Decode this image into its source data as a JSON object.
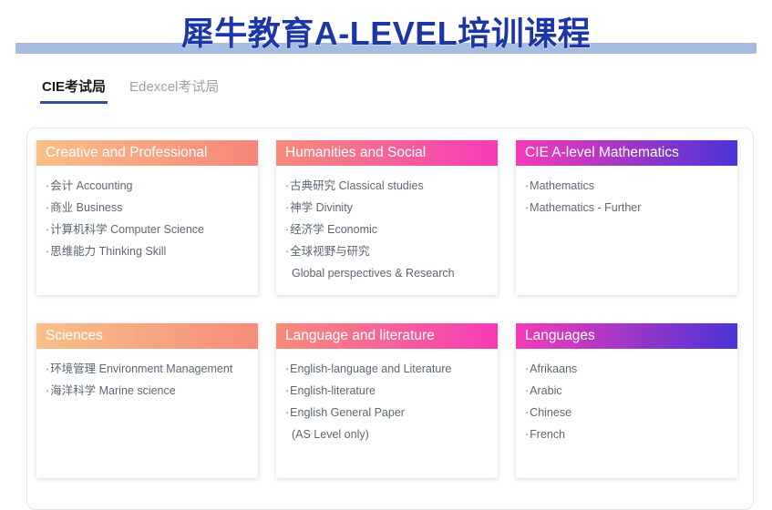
{
  "page": {
    "title": "犀牛教育A-LEVEL培训课程",
    "accent_bar_color": "#a8bce0",
    "title_color": "#1b36a6"
  },
  "tabs": [
    {
      "label": "CIE考试局",
      "active": true
    },
    {
      "label": "Edexcel考试局",
      "active": false
    }
  ],
  "cards": [
    {
      "title": "Creative and Professional",
      "gradient_from": "#f9c088",
      "gradient_to": "#f58679",
      "items": [
        {
          "text": "会计 Accounting",
          "bullet": true
        },
        {
          "text": "商业 Business",
          "bullet": true
        },
        {
          "text": "计算机科学 Computer Science",
          "bullet": true
        },
        {
          "text": "思维能力 Thinking Skill",
          "bullet": true
        }
      ]
    },
    {
      "title": "Humanities and Social",
      "gradient_from": "#f68c7a",
      "gradient_to": "#f53bb6",
      "items": [
        {
          "text": "古典研究 Classical studies",
          "bullet": true
        },
        {
          "text": "神学 Divinity",
          "bullet": true
        },
        {
          "text": "经济学 Economic",
          "bullet": true
        },
        {
          "text": "全球视野与研究",
          "bullet": true
        },
        {
          "text": "Global perspectives & Research",
          "bullet": false
        }
      ]
    },
    {
      "title": "CIE A-level Mathematics",
      "gradient_from": "#f53bb6",
      "gradient_to": "#4b33d8",
      "items": [
        {
          "text": "Mathematics",
          "bullet": true
        },
        {
          "text": "Mathematics - Further",
          "bullet": true
        }
      ]
    },
    {
      "title": "Sciences",
      "gradient_from": "#f9c088",
      "gradient_to": "#f58c7c",
      "items": [
        {
          "text": "环境管理 Environment Management",
          "bullet": true
        },
        {
          "text": "海洋科学 Marine science",
          "bullet": true
        }
      ]
    },
    {
      "title": "Language and literature",
      "gradient_from": "#f68c7a",
      "gradient_to": "#f53bb6",
      "items": [
        {
          "text": "English-language and Literature",
          "bullet": true
        },
        {
          "text": "English-literature",
          "bullet": true
        },
        {
          "text": "English General Paper",
          "bullet": true
        },
        {
          "text": "(AS Level only)",
          "bullet": false
        }
      ]
    },
    {
      "title": "Languages",
      "gradient_from": "#f53bb6",
      "gradient_to": "#4b33d8",
      "items": [
        {
          "text": "Afrikaans",
          "bullet": true
        },
        {
          "text": "Arabic",
          "bullet": true
        },
        {
          "text": "Chinese",
          "bullet": true
        },
        {
          "text": "French",
          "bullet": true
        }
      ]
    }
  ],
  "bullet_glyph": "·"
}
